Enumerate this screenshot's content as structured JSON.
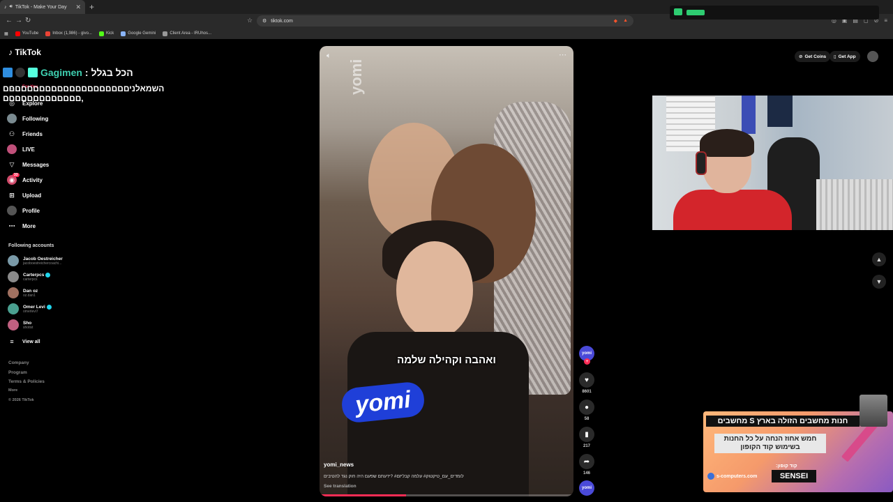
{
  "browser": {
    "tab_title": "TikTok - Make Your Day",
    "tab_close": "✕",
    "new_tab": "+",
    "url": "tiktok.com",
    "bookmarks": [
      {
        "label": "YouTube",
        "color": "#ff0000"
      },
      {
        "label": "Inbox (1,986) - givo...",
        "color": "#ea4335"
      },
      {
        "label": "Kick",
        "color": "#53fc18"
      },
      {
        "label": "Google Gemini",
        "color": "#8ab4f8"
      },
      {
        "label": "Client Area - IRUhos...",
        "color": "#999999"
      }
    ]
  },
  "tiktok": {
    "logo": "TikTok",
    "nav": [
      {
        "label": "For You",
        "icon": "home-icon"
      },
      {
        "label": "Explore",
        "icon": "compass-icon"
      },
      {
        "label": "Following",
        "icon": "following-avatar-icon"
      },
      {
        "label": "Friends",
        "icon": "friends-icon"
      },
      {
        "label": "LIVE",
        "icon": "live-icon"
      },
      {
        "label": "Messages",
        "icon": "messages-icon"
      },
      {
        "label": "Activity",
        "icon": "activity-icon",
        "badge": "33"
      },
      {
        "label": "Upload",
        "icon": "upload-icon"
      },
      {
        "label": "Profile",
        "icon": "profile-avatar-icon"
      },
      {
        "label": "More",
        "icon": "more-icon"
      }
    ],
    "following_title": "Following accounts",
    "accounts": [
      {
        "name": "Jacob Oestreicher",
        "handle": "jacoboestreichercoachi...",
        "verified": false,
        "color": "#7a9aa8"
      },
      {
        "name": "Carterpcs",
        "handle": "carterpcs",
        "verified": true,
        "color": "#8a8a8a"
      },
      {
        "name": "Dan oz",
        "handle": "oz.dan1",
        "verified": false,
        "color": "#a07060"
      },
      {
        "name": "Omer Levi",
        "handle": "omerlevi7",
        "verified": true,
        "color": "#4aa090"
      },
      {
        "name": "Sho",
        "handle": "shotist",
        "verified": false,
        "color": "#c06080"
      }
    ],
    "view_all": "View all",
    "footer": [
      "Company",
      "Program",
      "Terms & Policies",
      "More",
      "© 2026 TikTok"
    ],
    "get_coins": "Get Coins",
    "get_app": "Get App"
  },
  "chat": {
    "user": "Gagimen",
    "separator": ":",
    "hebrew_text": "הכל בגלל",
    "message": "השמאלניםםםםםםםםםםםםםםםםםםםםם םםםםםםםםםםםםם,"
  },
  "video": {
    "watermark": "yomi",
    "subtitle": "ואהבה וקהילה שלמה",
    "mic_logo": "yomi",
    "author": "yomi_news",
    "caption": "לומדים_עם_טיקטוק# עלמה קבליזם# ?ידעתם שפעם היה חוק נגד להטיבים",
    "see_translation": "See translation",
    "progress_fraction": 0.34
  },
  "actions": {
    "profile_label": "yomi",
    "likes": "8601",
    "comments": "58",
    "saves": "217",
    "shares": "146",
    "music_label": "yomi"
  },
  "ad": {
    "title": "חנות מחשבים הזולה בארץ S מחשבים",
    "subtitle": "חמש אחוז הנחה על כל החנות בשימוש קוד הקופון",
    "code_label": "קוד קופון:",
    "code": "SENSEI",
    "site": "s-computers.com"
  }
}
